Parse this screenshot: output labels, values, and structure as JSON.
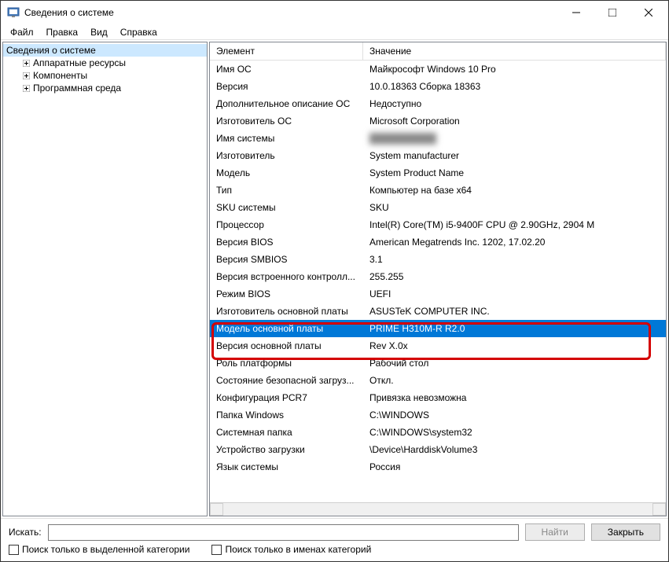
{
  "title": "Сведения о системе",
  "menu": {
    "file": "Файл",
    "edit": "Правка",
    "view": "Вид",
    "help": "Справка"
  },
  "sidebar": {
    "root": "Сведения о системе",
    "items": [
      {
        "label": "Аппаратные ресурсы"
      },
      {
        "label": "Компоненты"
      },
      {
        "label": "Программная среда"
      }
    ]
  },
  "columns": {
    "element": "Элемент",
    "value": "Значение"
  },
  "rows": [
    {
      "el": "Имя ОС",
      "val": "Майкрософт Windows 10 Pro"
    },
    {
      "el": "Версия",
      "val": "10.0.18363 Сборка 18363"
    },
    {
      "el": "Дополнительное описание ОС",
      "val": "Недоступно"
    },
    {
      "el": "Изготовитель ОС",
      "val": "Microsoft Corporation"
    },
    {
      "el": "Имя системы",
      "val": "",
      "blur": true
    },
    {
      "el": "Изготовитель",
      "val": "System manufacturer"
    },
    {
      "el": "Модель",
      "val": "System Product Name"
    },
    {
      "el": "Тип",
      "val": "Компьютер на базе x64"
    },
    {
      "el": "SKU системы",
      "val": "SKU"
    },
    {
      "el": "Процессор",
      "val": "Intel(R) Core(TM) i5-9400F CPU @ 2.90GHz, 2904 M"
    },
    {
      "el": "Версия BIOS",
      "val": "American Megatrends Inc. 1202, 17.02.20"
    },
    {
      "el": "Версия SMBIOS",
      "val": "3.1"
    },
    {
      "el": "Версия встроенного контролл...",
      "val": "255.255"
    },
    {
      "el": "Режим BIOS",
      "val": "UEFI"
    },
    {
      "el": "Изготовитель основной платы",
      "val": "ASUSTeK COMPUTER INC."
    },
    {
      "el": "Модель основной платы",
      "val": "PRIME H310M-R R2.0",
      "selected": true
    },
    {
      "el": "Версия основной платы",
      "val": "Rev X.0x"
    },
    {
      "el": "Роль платформы",
      "val": "Рабочий стол"
    },
    {
      "el": "Состояние безопасной загруз...",
      "val": "Откл."
    },
    {
      "el": "Конфигурация PCR7",
      "val": "Привязка невозможна"
    },
    {
      "el": "Папка Windows",
      "val": "C:\\WINDOWS"
    },
    {
      "el": "Системная папка",
      "val": "C:\\WINDOWS\\system32"
    },
    {
      "el": "Устройство загрузки",
      "val": "\\Device\\HarddiskVolume3"
    },
    {
      "el": "Язык системы",
      "val": "Россия"
    }
  ],
  "search": {
    "label": "Искать:",
    "find_btn": "Найти",
    "close_btn": "Закрыть",
    "check_category": "Поиск только в выделенной категории",
    "check_names": "Поиск только в именах категорий"
  }
}
